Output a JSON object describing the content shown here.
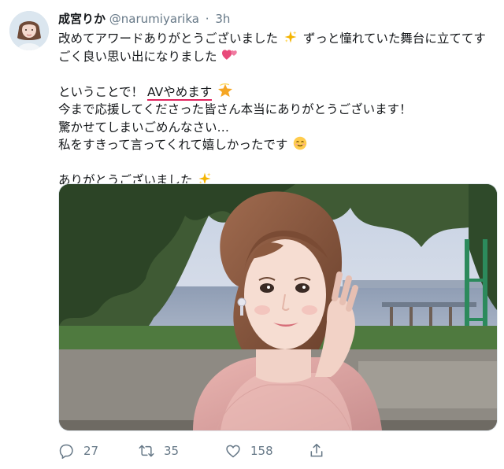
{
  "tweet": {
    "display_name": "成宮りか",
    "handle": "@narumiyarika",
    "separator": "·",
    "time": "3h",
    "lines": [
      "改めてアワードありがとうございました",
      "ずっと憧れていた舞台に立ててす",
      "ごく良い思い出になりました",
      "ということで！",
      "AVやめます",
      "今まで応援してくださった皆さん本当にありがとうございます！",
      "驚かせてしまいごめんなさい…",
      "私をすきって言ってくれて嬉しかったです",
      "ありがとうございました"
    ],
    "icons": {
      "avatar": "avatar-icon",
      "sparkles": "sparkles-icon",
      "hearts": "two-hearts-icon",
      "star": "star-icon",
      "face": "smiling-face-icon",
      "reply": "reply-icon",
      "retweet": "retweet-icon",
      "like": "heart-icon",
      "share": "share-icon"
    },
    "stats": {
      "replies": "27",
      "retweets": "35",
      "likes": "158"
    },
    "colors": {
      "text": "#14171a",
      "muted": "#657786",
      "underline": "#e0245e",
      "border": "#e1e8ed"
    }
  }
}
